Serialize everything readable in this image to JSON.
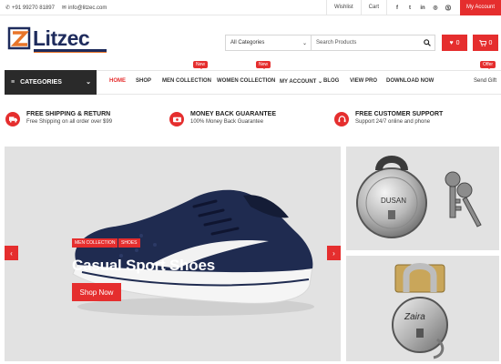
{
  "topbar": {
    "phone": "+91 99270 81897",
    "email": "info@litzec.com",
    "wishlist": "Wishlist",
    "cart": "Cart",
    "social": [
      "f",
      "t",
      "in",
      "ig",
      "p"
    ],
    "my_account": "My Account"
  },
  "brand": {
    "name": "Litzec",
    "primary": "#1e2b5c",
    "accent": "#e52e2e",
    "orange": "#e8752a"
  },
  "search": {
    "category": "All Categories",
    "placeholder": "Search Products"
  },
  "header_buttons": {
    "wishlist_count": "0",
    "cart_count": "0"
  },
  "nav": {
    "categories": "CATEGORIES",
    "items": [
      "HOME",
      "SHOP",
      "MEN COLLECTION",
      "WOMEN COLLECTION",
      "MY ACCOUNT",
      "BLOG",
      "VIEW PRO",
      "DOWNLOAD NOW"
    ],
    "tag_new": "New",
    "tag_offer": "Offer",
    "send_gift": "Send Gift"
  },
  "features": [
    {
      "title": "FREE SHIPPING & RETURN",
      "sub": "Free Shipping on all order over $99"
    },
    {
      "title": "MONEY BACK GUARANTEE",
      "sub": "100% Money Back Guarantee"
    },
    {
      "title": "FREE CUSTOMER SUPPORT",
      "sub": "Support 24/7 online and phone"
    }
  ],
  "slide": {
    "chips": [
      "MEN COLLECTION",
      "SHOES"
    ],
    "title": "Casual Sport Shoes",
    "button": "Shop Now"
  },
  "side_products": [
    {
      "brand": "DUSAN",
      "icon": "padlock-round-icon"
    },
    {
      "brand": "Zaira",
      "icon": "padlock-shackle-icon"
    }
  ]
}
